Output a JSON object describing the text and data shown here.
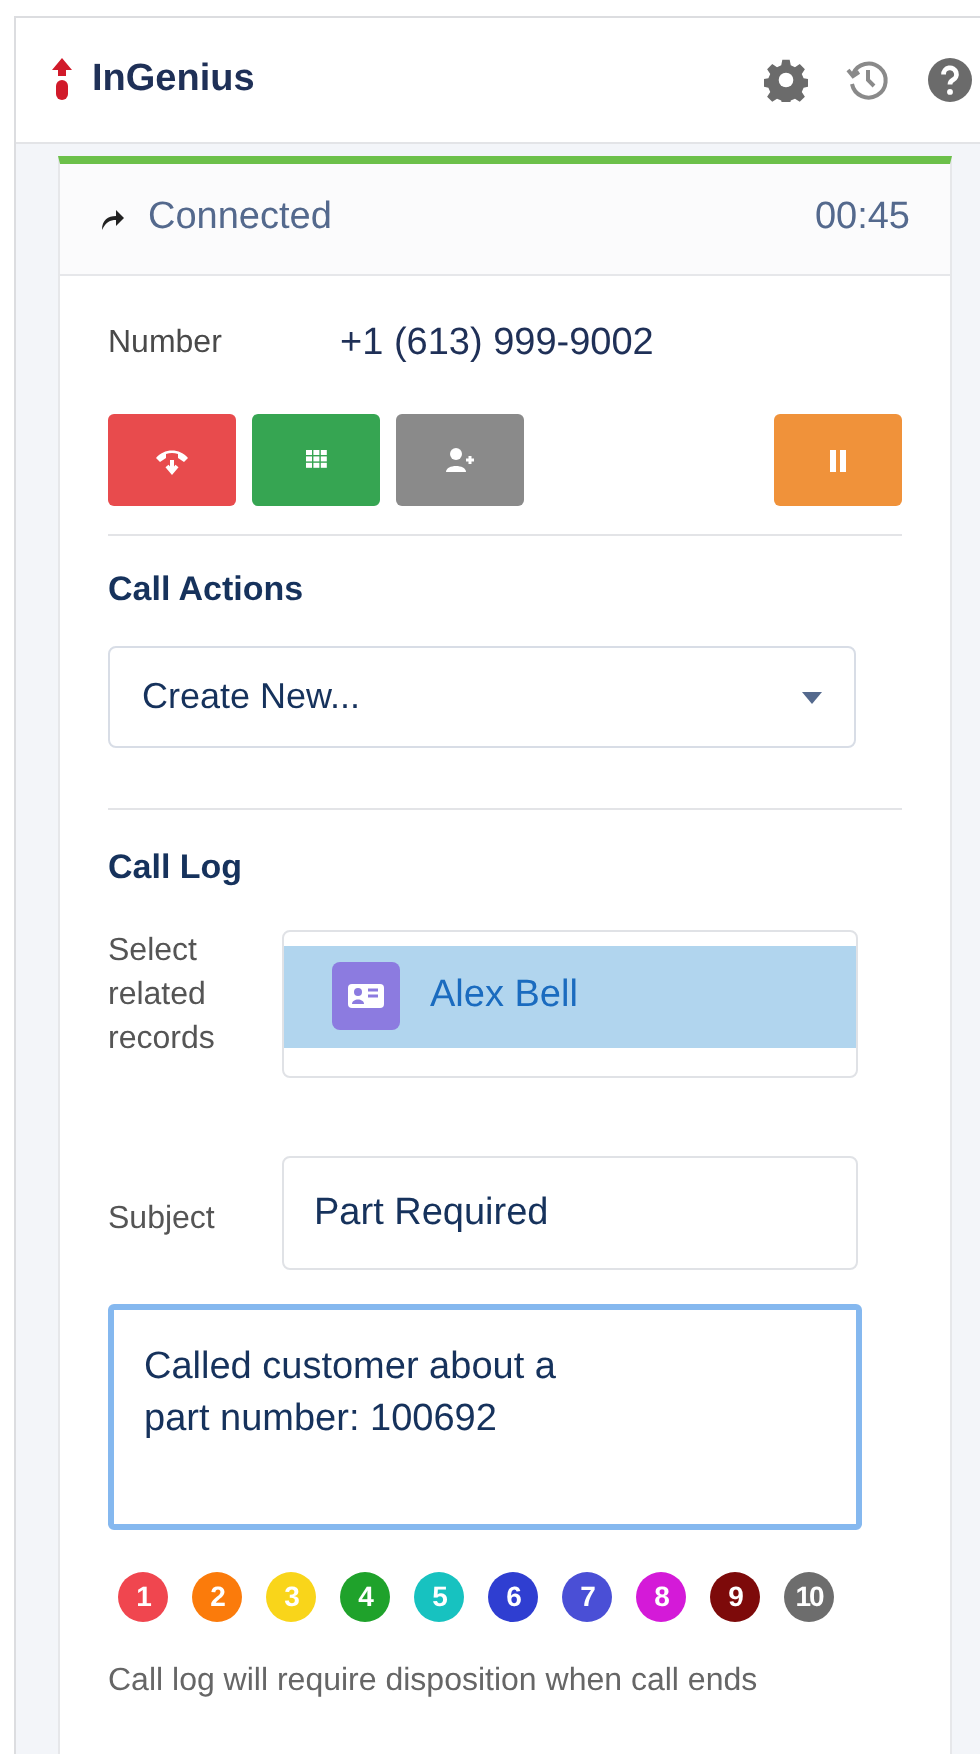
{
  "header": {
    "title": "InGenius"
  },
  "call": {
    "status": "Connected",
    "timer": "00:45",
    "number_label": "Number",
    "number": "+1 (613) 999-9002"
  },
  "call_buttons": [
    {
      "kind": "hangup"
    },
    {
      "kind": "keypad"
    },
    {
      "kind": "transfer"
    },
    {
      "kind": "hold"
    }
  ],
  "call_actions": {
    "heading": "Call Actions",
    "dropdown_value": "Create New..."
  },
  "call_log": {
    "heading": "Call Log",
    "related_label": "Select related records",
    "related_record": "Alex Bell",
    "subject_label": "Subject",
    "subject_value": "Part Required",
    "notes": "Called customer about a\npart number: 100692"
  },
  "dispositions": [
    {
      "label": "1",
      "color": "#f0464f"
    },
    {
      "label": "2",
      "color": "#fb7b0b"
    },
    {
      "label": "3",
      "color": "#f9d51a"
    },
    {
      "label": "4",
      "color": "#1fa22b"
    },
    {
      "label": "5",
      "color": "#17c2c0"
    },
    {
      "label": "6",
      "color": "#2f3ed1"
    },
    {
      "label": "7",
      "color": "#4a4fd6"
    },
    {
      "label": "8",
      "color": "#d41ad8"
    },
    {
      "label": "9",
      "color": "#7d0a0a"
    },
    {
      "label": "10",
      "color": "#6d6d6d"
    }
  ],
  "footer_note": "Call log will require disposition when call ends"
}
